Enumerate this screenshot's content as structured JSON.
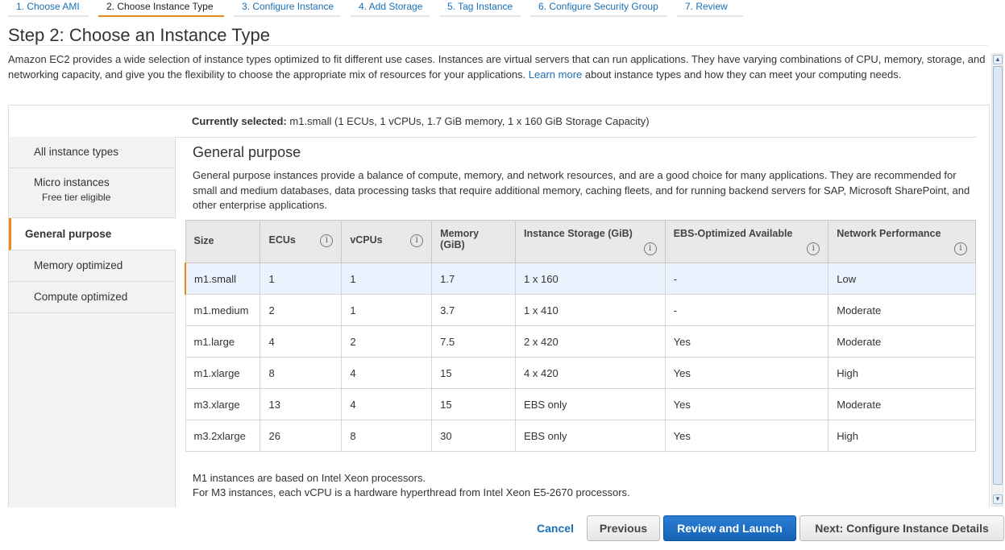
{
  "steps": [
    {
      "label": "1. Choose AMI",
      "active": false
    },
    {
      "label": "2. Choose Instance Type",
      "active": true
    },
    {
      "label": "3. Configure Instance",
      "active": false
    },
    {
      "label": "4. Add Storage",
      "active": false
    },
    {
      "label": "5. Tag Instance",
      "active": false
    },
    {
      "label": "6. Configure Security Group",
      "active": false
    },
    {
      "label": "7. Review",
      "active": false
    }
  ],
  "page": {
    "title": "Step 2: Choose an Instance Type",
    "intro_before": "Amazon EC2 provides a wide selection of instance types optimized to fit different use cases. Instances are virtual servers that can run applications. They have varying combinations of CPU, memory, storage, and networking capacity, and give you the flexibility to choose the appropriate mix of resources for your applications.",
    "learn_more": "Learn more",
    "intro_after": "about instance types and how they can meet your computing needs."
  },
  "current": {
    "label": "Currently selected:",
    "value": "m1.small (1 ECUs, 1 vCPUs, 1.7 GiB memory, 1 x 160 GiB Storage Capacity)"
  },
  "sidebar": {
    "items": [
      {
        "label": "All instance types",
        "sub": ""
      },
      {
        "label": "Micro instances",
        "sub": "Free tier eligible"
      },
      {
        "label": "General purpose",
        "sub": ""
      },
      {
        "label": "Memory optimized",
        "sub": ""
      },
      {
        "label": "Compute optimized",
        "sub": ""
      }
    ]
  },
  "main": {
    "heading": "General purpose",
    "description": "General purpose instances provide a balance of compute, memory, and network resources, and are a good choice for many applications. They are recommended for small and medium databases, data processing tasks that require additional memory, caching fleets, and for running backend servers for SAP, Microsoft SharePoint, and other enterprise applications."
  },
  "table": {
    "headers": {
      "size": "Size",
      "ecus": "ECUs",
      "vcpus": "vCPUs",
      "memory_line1": "Memory",
      "memory_line2": "(GiB)",
      "storage": "Instance Storage (GiB)",
      "ebs": "EBS-Optimized Available",
      "network": "Network Performance"
    },
    "info_glyph": "i",
    "rows": [
      {
        "size": "m1.small",
        "ecus": "1",
        "vcpus": "1",
        "memory": "1.7",
        "storage": "1 x 160",
        "ebs": "-",
        "network": "Low"
      },
      {
        "size": "m1.medium",
        "ecus": "2",
        "vcpus": "1",
        "memory": "3.7",
        "storage": "1 x 410",
        "ebs": "-",
        "network": "Moderate"
      },
      {
        "size": "m1.large",
        "ecus": "4",
        "vcpus": "2",
        "memory": "7.5",
        "storage": "2 x 420",
        "ebs": "Yes",
        "network": "Moderate"
      },
      {
        "size": "m1.xlarge",
        "ecus": "8",
        "vcpus": "4",
        "memory": "15",
        "storage": "4 x 420",
        "ebs": "Yes",
        "network": "High"
      },
      {
        "size": "m3.xlarge",
        "ecus": "13",
        "vcpus": "4",
        "memory": "15",
        "storage": "EBS only",
        "ebs": "Yes",
        "network": "Moderate"
      },
      {
        "size": "m3.2xlarge",
        "ecus": "26",
        "vcpus": "8",
        "memory": "30",
        "storage": "EBS only",
        "ebs": "Yes",
        "network": "High"
      }
    ]
  },
  "notes": {
    "line1": "M1 instances are based on Intel Xeon processors.",
    "line2": "For M3 instances, each vCPU is a hardware hyperthread from Intel Xeon E5-2670 processors."
  },
  "footer": {
    "cancel": "Cancel",
    "previous": "Previous",
    "review_launch": "Review and Launch",
    "next": "Next: Configure Instance Details"
  },
  "colors": {
    "accent_orange": "#e88a1a",
    "link_blue": "#1a6fb5",
    "primary_blue": "#1663b5"
  },
  "icons": {
    "scroll_up": "▲",
    "scroll_down": "▼",
    "info": "info-icon"
  }
}
